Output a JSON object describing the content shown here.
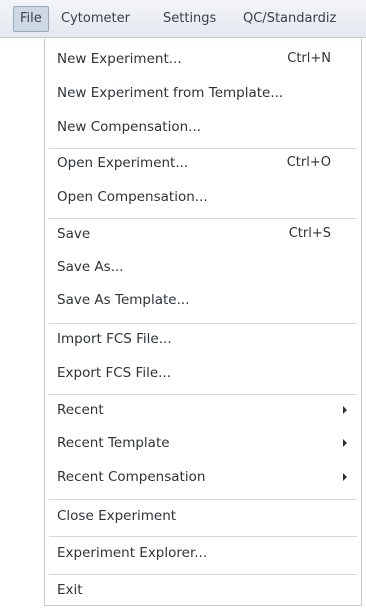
{
  "menubar": {
    "items": [
      {
        "label": "File"
      },
      {
        "label": "Cytometer"
      },
      {
        "label": "Settings"
      },
      {
        "label": "QC/Standardiz"
      }
    ]
  },
  "file_menu": {
    "items": [
      {
        "label": "New Experiment...",
        "shortcut": "Ctrl+N"
      },
      {
        "label": "New Experiment from Template..."
      },
      {
        "label": "New Compensation..."
      },
      {
        "label": "Open Experiment...",
        "shortcut": "Ctrl+O"
      },
      {
        "label": "Open Compensation..."
      },
      {
        "label": "Save",
        "shortcut": "Ctrl+S"
      },
      {
        "label": "Save As..."
      },
      {
        "label": "Save As Template..."
      },
      {
        "label": "Import FCS File..."
      },
      {
        "label": "Export FCS File..."
      },
      {
        "label": "Recent",
        "submenu": true
      },
      {
        "label": "Recent Template",
        "submenu": true
      },
      {
        "label": "Recent Compensation",
        "submenu": true
      },
      {
        "label": "Close Experiment"
      },
      {
        "label": "Experiment Explorer..."
      },
      {
        "label": "Exit"
      }
    ]
  }
}
